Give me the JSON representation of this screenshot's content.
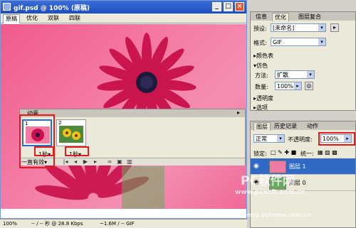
{
  "document": {
    "title": "gif.psd @ 100% (原稿)",
    "tabs": [
      "原稿",
      "优化",
      "双联",
      "四联"
    ],
    "active_tab": 0
  },
  "animation": {
    "title": "动画",
    "frames": [
      {
        "number": "1",
        "delay": "1秒"
      },
      {
        "number": "2",
        "delay": "1秒"
      }
    ],
    "loop": "一直有效"
  },
  "statusbar": {
    "zoom": "100%",
    "size": "-- / -- 秒 @ 28.8 Kbps",
    "file": "~1.6M / -- GIF"
  },
  "info_panel": {
    "tabs": [
      "信息",
      "优化",
      "图层复合"
    ],
    "active_tab": 1,
    "preset_label": "预设:",
    "preset_value": "[未命名]",
    "format_label": "格式:",
    "format_value": "GIF",
    "color_table": "颜色表",
    "dither_section": "仿色",
    "method_label": "方法:",
    "method_value": "扩散",
    "amount_label": "数量:",
    "amount_value": "100%",
    "transparency": "透明度",
    "options": "选项"
  },
  "layers_panel": {
    "tabs": [
      "图层",
      "历史记录",
      "动作"
    ],
    "active_tab": 0,
    "blend_mode": "正常",
    "opacity_label": "不透明度:",
    "opacity_value": "100%",
    "lock_label": "锁定:",
    "unify_label": "统一:",
    "layers": [
      {
        "name": "图层 1",
        "selected": true
      },
      {
        "name": "图层 0",
        "selected": false
      }
    ]
  },
  "watermark": {
    "brand": "PC软件网",
    "url": "www.pcsoft.com.cn",
    "extra": "jiaocheng.pchome.com.cn"
  },
  "colors": {
    "canvas_pink": "#f07aa2",
    "flower_red": "#c8104a",
    "highlight_red": "#e21a1a",
    "titlebar_blue": "#2b5fd0",
    "selection_blue": "#316ac5"
  }
}
